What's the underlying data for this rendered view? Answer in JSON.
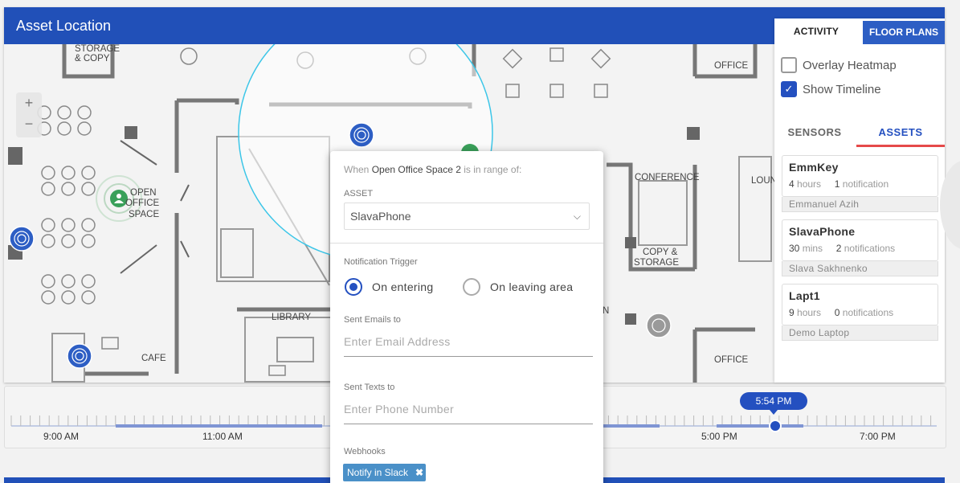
{
  "header": {
    "title": "Asset Location"
  },
  "side_panel": {
    "tabs": {
      "activity": "ACTIVITY",
      "floor_plans": "FLOOR PLANS"
    },
    "options": {
      "overlay_heatmap": "Overlay Heatmap",
      "show_timeline": "Show Timeline",
      "overlay_heatmap_checked": false,
      "show_timeline_checked": true
    },
    "subtabs": {
      "sensors": "SENSORS",
      "assets": "ASSETS",
      "active": "ASSETS"
    },
    "assets": [
      {
        "name": "EmmKey",
        "time_value": "4",
        "time_unit": "hours",
        "notif_value": "1",
        "notif_unit": "notification",
        "owner": "Emmanuel Azih"
      },
      {
        "name": "SlavaPhone",
        "time_value": "30",
        "time_unit": "mins",
        "notif_value": "2",
        "notif_unit": "notifications",
        "owner": "Slava Sakhnenko"
      },
      {
        "name": "Lapt1",
        "time_value": "9",
        "time_unit": "hours",
        "notif_value": "0",
        "notif_unit": "notifications",
        "owner": "Demo Laptop"
      }
    ]
  },
  "map": {
    "zoom_in": "+",
    "zoom_out": "−",
    "labels": {
      "storage": "STORAGE",
      "copy": "& COPY",
      "open": "OPEN",
      "office_word": "OFFICE",
      "space": "SPACE",
      "office_top": "OFFICE",
      "conference": "CONFERENCE",
      "lounge": "LOUN",
      "copy_storage_1": "COPY &",
      "copy_storage_2": "STORAGE",
      "library": "LIBRARY",
      "cafe": "CAFE",
      "office_bottom": "OFFICE",
      "n": "N"
    }
  },
  "popup": {
    "when_prefix": "When",
    "location": "Open Office Space 2",
    "when_suffix": "is in range of:",
    "asset_label": "ASSET",
    "asset_value": "SlavaPhone",
    "trigger_label": "Notification Trigger",
    "radio_entering": "On entering",
    "radio_leaving": "On leaving area",
    "selected_trigger": "On entering",
    "emails_label": "Sent Emails to",
    "emails_placeholder": "Enter Email Address",
    "texts_label": "Sent Texts to",
    "texts_placeholder": "Enter Phone Number",
    "webhooks_label": "Webhooks",
    "webhook_chip": "Notify in Slack"
  },
  "timeline": {
    "ticks": [
      "9:00 AM",
      "11:00 AM",
      "5:00 PM",
      "7:00 PM"
    ],
    "current_time": "5:54 PM"
  },
  "colors": {
    "header": "#2150b8",
    "accent": "#2450c0",
    "active_tab_underline": "#e54a4a",
    "chip": "#4a90c8"
  }
}
